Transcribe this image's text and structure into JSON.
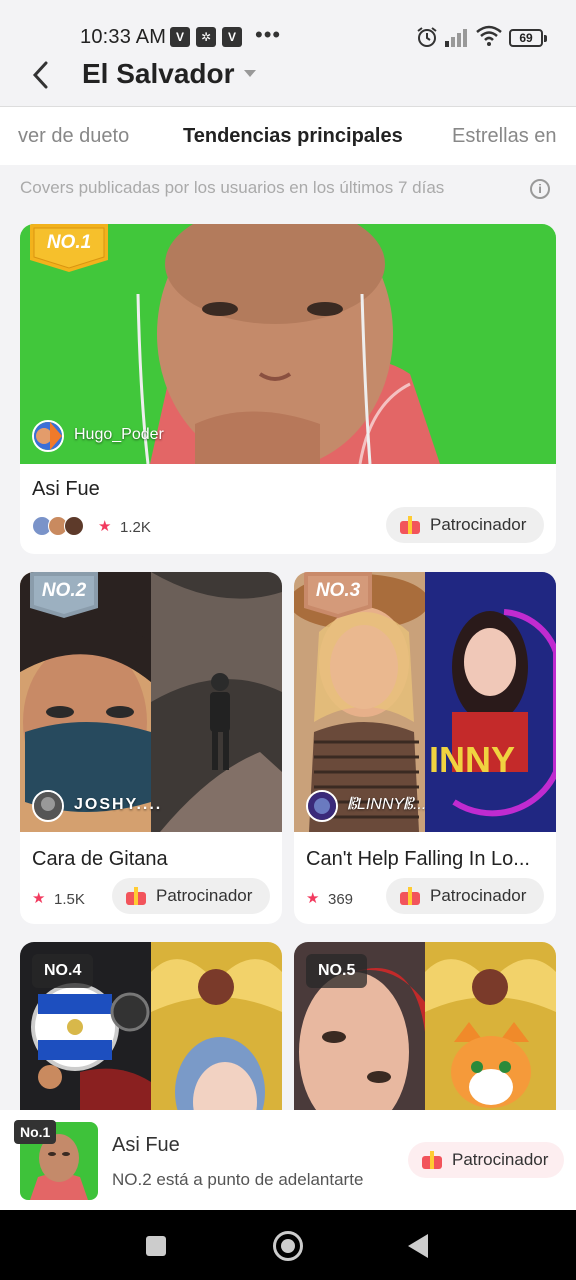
{
  "status_bar": {
    "time": "10:33 AM",
    "app_icons": [
      "V",
      "✲",
      "V"
    ],
    "more": "•••",
    "battery": "69"
  },
  "header": {
    "title": "El Salvador",
    "back_icon": "chevron-left-icon",
    "dropdown_icon": "caret-down-icon"
  },
  "tabs": [
    {
      "label": "ver de dueto",
      "active": false
    },
    {
      "label": "Tendencias principales",
      "active": true
    },
    {
      "label": "Estrellas en",
      "active": false
    }
  ],
  "subtitle": "Covers publicadas por los usuarios en los últimos 7 días",
  "info_icon": "i",
  "cards": [
    {
      "rank": "NO.1",
      "username": "Hugo_Poder",
      "title": "Asi Fue",
      "stars": "1.2K",
      "sponsor": "Patrocinador"
    },
    {
      "rank": "NO.2",
      "username": "JOSHY....",
      "title": "Cara de Gitana",
      "stars": "1.5K",
      "sponsor": "Patrocinador"
    },
    {
      "rank": "NO.3",
      "username": "𝄡LINNY𝄡...",
      "title": "Can't Help Falling In Lo...",
      "stars": "369",
      "sponsor": "Patrocinador"
    },
    {
      "rank": "NO.4"
    },
    {
      "rank": "NO.5"
    }
  ],
  "star_icon": "★",
  "banner": {
    "rank": "No.1",
    "title": "Asi Fue",
    "subtitle": "NO.2 está a punto de adelantarte",
    "sponsor": "Patrocinador"
  },
  "colors": {
    "accent": "#f23b5f",
    "gold_badge": "#f2b21c",
    "silver_badge": "#8a9cab",
    "bronze_badge": "#c98a6a"
  }
}
